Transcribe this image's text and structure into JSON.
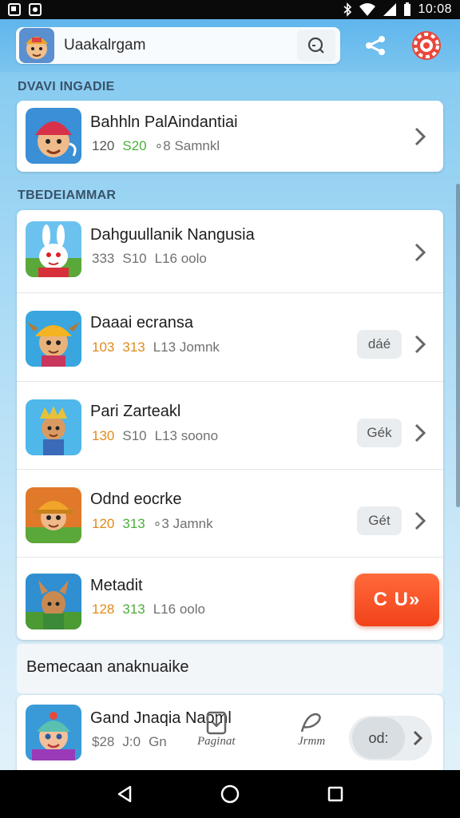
{
  "status_bar": {
    "time": "10:08"
  },
  "app_bar": {
    "search_value": "Uaakalrgam",
    "icons": [
      "app-avatar",
      "search-icon",
      "share-icon",
      "settings-icon"
    ]
  },
  "sections": {
    "top_label": "DVAVI INGADIE",
    "list_label": "TBEDEIAMMAR",
    "recommend_label": "Bemecaan anaknuaike"
  },
  "top_card": {
    "title": "Bahhln PalAindantiai",
    "meta": [
      "120",
      "S20",
      "∘8 Samnkl"
    ]
  },
  "list": [
    {
      "title": "Dahguullanik Nangusia",
      "meta": [
        "333",
        "S10",
        "L16 oolo"
      ],
      "action": ""
    },
    {
      "title": "Daaai ecransa",
      "meta": [
        "103",
        "313",
        "L13 Jomnk"
      ],
      "action": "dáé"
    },
    {
      "title": "Pari Zarteakl",
      "meta": [
        "130",
        "S10",
        "L13 soono"
      ],
      "action": "Gék"
    },
    {
      "title": "Odnd eocrke",
      "meta": [
        "120",
        "313",
        "∘3 Jamnk"
      ],
      "action": "Gét"
    },
    {
      "title": "Metadit",
      "meta": [
        "128",
        "313",
        "L16 oolo"
      ],
      "action": "C U»"
    }
  ],
  "bottom_card": {
    "title": "Gand Jnaqia Naoml",
    "meta": [
      "$28",
      "J:0",
      "Gn"
    ],
    "nav_items": [
      "Paginat",
      "Jrmm"
    ],
    "pill_label": "od:"
  },
  "colors": {
    "accent_orange": "#f2421a",
    "meta_orange": "#e08a1a",
    "meta_green": "#4cae3a",
    "sky_blue": "#7cc6ef"
  }
}
